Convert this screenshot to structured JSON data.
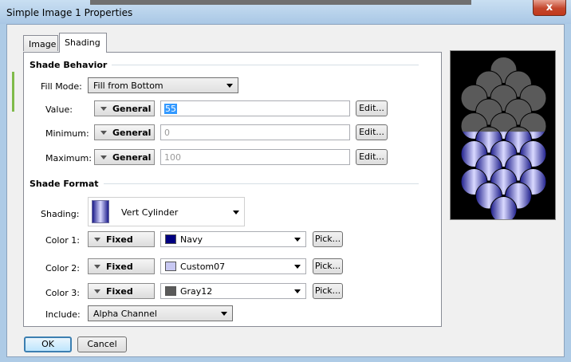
{
  "window": {
    "title": "Simple Image 1 Properties",
    "close_glyph": "x"
  },
  "tabs": [
    {
      "label": "Image"
    },
    {
      "label": "Shading"
    }
  ],
  "shade_behavior": {
    "title": "Shade Behavior",
    "fill_mode_label": "Fill Mode:",
    "fill_mode_value": "Fill from Bottom",
    "rows": [
      {
        "label": "Value:",
        "mode": "General",
        "value": "55",
        "edit": "Edit..."
      },
      {
        "label": "Minimum:",
        "mode": "General",
        "value": "0",
        "edit": "Edit..."
      },
      {
        "label": "Maximum:",
        "mode": "General",
        "value": "100",
        "edit": "Edit..."
      }
    ]
  },
  "shade_format": {
    "title": "Shade Format",
    "shading_label": "Shading:",
    "shading_value": "Vert Cylinder",
    "colors": [
      {
        "label": "Color 1:",
        "mode": "Fixed",
        "color_name": "Navy",
        "swatch": "#000080",
        "pick": "Pick..."
      },
      {
        "label": "Color 2:",
        "mode": "Fixed",
        "color_name": "Custom07",
        "swatch": "#c8c8f2",
        "pick": "Pick..."
      },
      {
        "label": "Color 3:",
        "mode": "Fixed",
        "color_name": "Gray12",
        "swatch": "#5a5a5a",
        "pick": "Pick..."
      }
    ],
    "include_label": "Include:",
    "include_value": "Alpha Channel"
  },
  "buttons": {
    "ok": "OK",
    "cancel": "Cancel"
  },
  "preview": {
    "fill_fraction": 0.55,
    "filled_palette": [
      "#1c1c8a",
      "#d9d9ff"
    ],
    "empty_color": "#5a5a5a"
  }
}
